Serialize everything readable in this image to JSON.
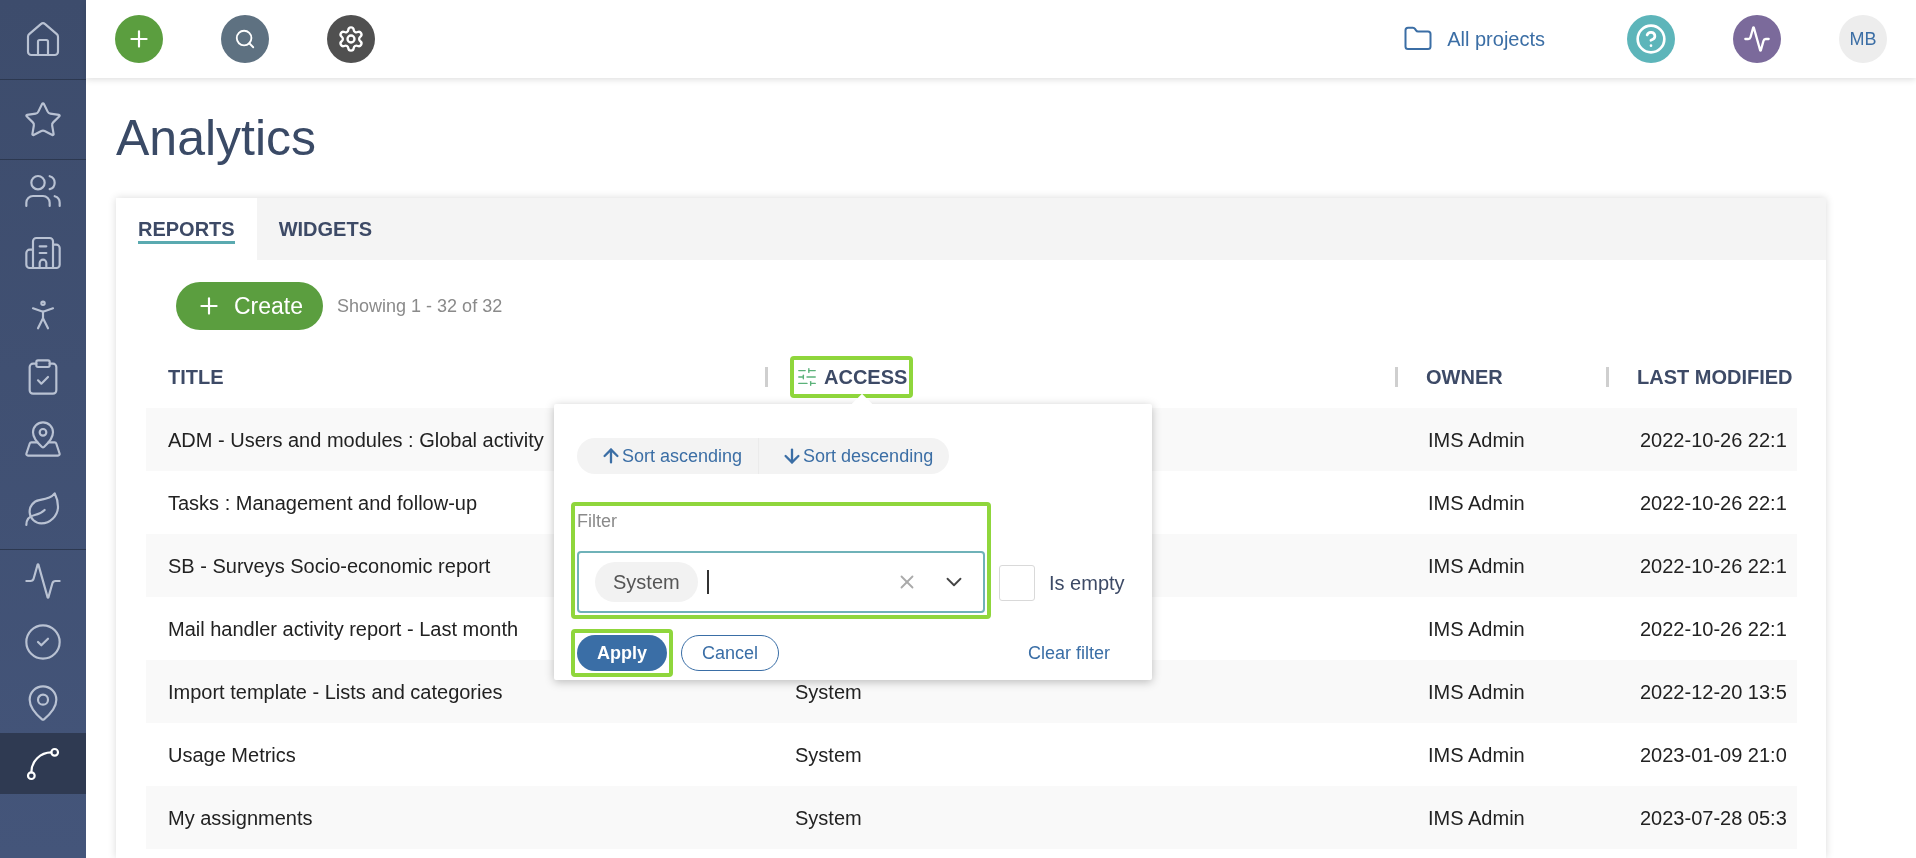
{
  "sidebar": {
    "items": [
      {
        "selected": false
      },
      {
        "selected": false
      },
      {
        "selected": false
      },
      {
        "selected": false
      },
      {
        "selected": false
      },
      {
        "selected": false
      },
      {
        "selected": false
      },
      {
        "selected": false
      },
      {
        "selected": false
      },
      {
        "selected": false
      },
      {
        "selected": false
      },
      {
        "selected": true
      }
    ]
  },
  "topbar": {
    "projects_link": "All projects",
    "avatar": "MB"
  },
  "page_title": "Analytics",
  "tabs": [
    {
      "label": "REPORTS",
      "selected": true
    },
    {
      "label": "WIDGETS",
      "selected": false
    }
  ],
  "create_button": "Create",
  "showing": "Showing 1 - 32 of 32",
  "table": {
    "columns": [
      {
        "label": "TITLE",
        "highlighted": false,
        "filtered": false
      },
      {
        "label": "ACCESS",
        "highlighted": true,
        "filtered": true
      },
      {
        "label": "OWNER",
        "highlighted": false,
        "filtered": false
      },
      {
        "label": "LAST MODIFIED",
        "highlighted": false,
        "filtered": false
      }
    ],
    "rows": [
      {
        "title": "ADM - Users and modules : Global activity",
        "owner": "IMS Admin",
        "last_modified": "2022-10-26 22:1"
      },
      {
        "title": "Tasks : Management and follow-up",
        "owner": "IMS Admin",
        "last_modified": "2022-10-26 22:1"
      },
      {
        "title": "SB - Surveys Socio-economic report",
        "owner": "IMS Admin",
        "last_modified": "2022-10-26 22:1"
      },
      {
        "title": "Mail handler activity report - Last month",
        "owner": "IMS Admin",
        "last_modified": "2022-10-26 22:1"
      },
      {
        "title": "Import template - Lists and categories",
        "access": "System",
        "owner": "IMS Admin",
        "last_modified": "2022-12-20 13:5"
      },
      {
        "title": "Usage Metrics",
        "access": "System",
        "owner": "IMS Admin",
        "last_modified": "2023-01-09 21:0"
      },
      {
        "title": "My assignments",
        "access": "System",
        "owner": "IMS Admin",
        "last_modified": "2023-07-28 05:3"
      }
    ]
  },
  "column_popup": {
    "sort_buttons": [
      {
        "kind": "ascending",
        "label": "Sort ascending"
      },
      {
        "kind": "descending",
        "label": "Sort descending"
      }
    ],
    "filter": {
      "label": "Filter",
      "highlighted": true,
      "chips": [
        "System"
      ]
    },
    "is_empty": {
      "label": "Is empty",
      "checked": false
    },
    "apply": {
      "label": "Apply",
      "highlighted": true
    },
    "cancel": "Cancel",
    "clear": "Clear filter"
  }
}
